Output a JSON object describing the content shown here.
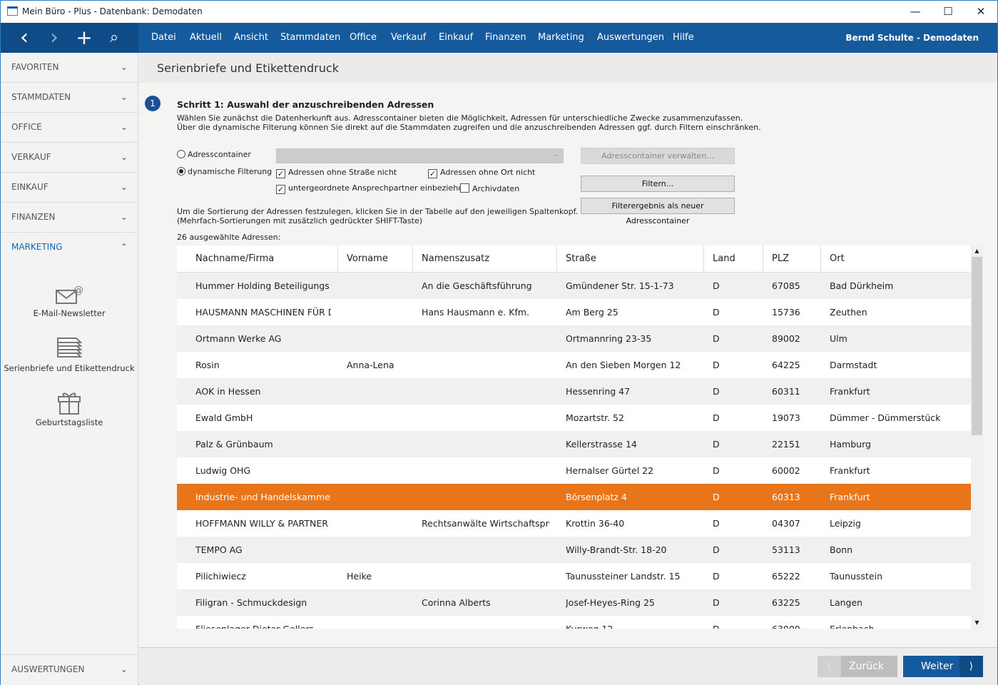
{
  "window": {
    "title": "Mein Büro - Plus - Datenbank: Demodaten",
    "minimize": "—",
    "maximize": "☐",
    "close": "✕"
  },
  "nav": {
    "back": "‹",
    "forward": "›",
    "add": "+",
    "search": "⌕",
    "menu": [
      "Datei",
      "Aktuell",
      "Ansicht",
      "Stammdaten",
      "Office",
      "Verkauf",
      "Einkauf",
      "Finanzen",
      "Marketing",
      "Auswertungen",
      "Hilfe"
    ],
    "user": "Bernd Schulte - Demodaten"
  },
  "sidebar": {
    "sections": [
      "FAVORITEN",
      "STAMMDATEN",
      "OFFICE",
      "VERKAUF",
      "EINKAUF",
      "FINANZEN",
      "MARKETING"
    ],
    "active": "MARKETING",
    "tools": [
      {
        "label": "E-Mail-Newsletter",
        "icon": "mail-at-icon"
      },
      {
        "label": "Serienbriefe und Etikettendruck",
        "icon": "stacked-letters-icon"
      },
      {
        "label": "Geburtstagsliste",
        "icon": "gift-icon"
      }
    ],
    "bottom": "AUSWERTUNGEN"
  },
  "page": {
    "title": "Serienbriefe und Etikettendruck",
    "step_number": "1",
    "step_title": "Schritt 1: Auswahl der anzuschreibenden Adressen",
    "intro1": "Wählen Sie zunächst die Datenherkunft aus. Adresscontainer bieten die Möglichkeit, Adressen für unterschiedliche Zwecke zusammenzufassen.",
    "intro2": "Über die dynamische Filterung können Sie direkt auf die Stammdaten zugreifen und die anzuschreibenden Adressen ggf. durch Filtern einschränken.",
    "radio_container": "Adresscontainer",
    "radio_dynamic": "dynamische Filterung",
    "radio_selected": "dynamische Filterung",
    "cb_street": {
      "label": "Adressen ohne Straße nicht",
      "checked": true
    },
    "cb_city": {
      "label": "Adressen ohne Ort nicht",
      "checked": true
    },
    "cb_sub": {
      "label": "untergeordnete Ansprechpartner einbeziehen",
      "checked": true
    },
    "cb_archive": {
      "label": "Archivdaten",
      "checked": false
    },
    "btn_manage": "Adresscontainer verwalten...",
    "btn_filter": "Filtern...",
    "btn_save": "Filterergebnis als neuer Adresscontainer",
    "sort_hint1": "Um die Sortierung der Adressen festzulegen, klicken Sie in der Tabelle auf den jeweiligen Spaltenkopf.",
    "sort_hint2": "(Mehrfach-Sortierungen mit zusätzlich gedrückter SHIFT-Taste)",
    "count": "26 ausgewählte Adressen:"
  },
  "table": {
    "columns": [
      "Nachname/Firma",
      "Vorname",
      "Namenszusatz",
      "Straße",
      "Land",
      "PLZ",
      "Ort"
    ],
    "selected_index": 8,
    "rows": [
      [
        "Hummer Holding Beteiligungs Gr",
        "",
        "An die Geschäftsführung",
        "Gmündener Str. 15-1-73",
        "D",
        "67085",
        "Bad Dürkheim"
      ],
      [
        "HAUSMANN MASCHINEN FÜR D",
        "",
        "Hans Hausmann e. Kfm.",
        "Am Berg 25",
        "D",
        "15736",
        "Zeuthen"
      ],
      [
        "Ortmann Werke AG",
        "",
        "",
        "Ortmannring 23-35",
        "D",
        "89002",
        "Ulm"
      ],
      [
        "Rosin",
        "Anna-Lena",
        "",
        "An den Sieben Morgen 12",
        "D",
        "64225",
        "Darmstadt"
      ],
      [
        "AOK in Hessen",
        "",
        "",
        "Hessenring 47",
        "D",
        "60311",
        "Frankfurt"
      ],
      [
        "Ewald GmbH",
        "",
        "",
        "Mozartstr. 52",
        "D",
        "19073",
        "Dümmer - Dümmerstück"
      ],
      [
        "Palz & Grünbaum",
        "",
        "",
        "Kellerstrasse 14",
        "D",
        "22151",
        "Hamburg"
      ],
      [
        "Ludwig OHG",
        "",
        "",
        "Hernalser Gürtel 22",
        "D",
        "60002",
        "Frankfurt"
      ],
      [
        "Industrie- und Handelskammer F",
        "",
        "",
        "Börsenplatz 4",
        "D",
        "60313",
        "Frankfurt"
      ],
      [
        "HOFFMANN WILLY & PARTNER",
        "",
        "Rechtsanwälte Wirtschaftsprüfe",
        "Krottin 36-40",
        "D",
        "04307",
        "Leipzig"
      ],
      [
        "TEMPO AG",
        "",
        "",
        "Willy-Brandt-Str. 18-20",
        "D",
        "53113",
        "Bonn"
      ],
      [
        "Pilichiwiecz",
        "Heike",
        "",
        "Taunussteiner Landstr. 15",
        "D",
        "65222",
        "Taunusstein"
      ],
      [
        "Filigran - Schmuckdesign",
        "",
        "Corinna Alberts",
        "Josef-Heyes-Ring 25",
        "D",
        "63225",
        "Langen"
      ],
      [
        "Fliesenlager Dieter Gellers",
        "",
        "",
        "Kurweg 12",
        "D",
        "63000",
        "Erlenbach"
      ]
    ]
  },
  "footer": {
    "back": "Zurück",
    "next": "Weiter"
  },
  "colors": {
    "nav": "#155a9c",
    "nav_dark": "#0e4b87",
    "selected_row": "#e8751a",
    "accent": "#1565b5"
  }
}
